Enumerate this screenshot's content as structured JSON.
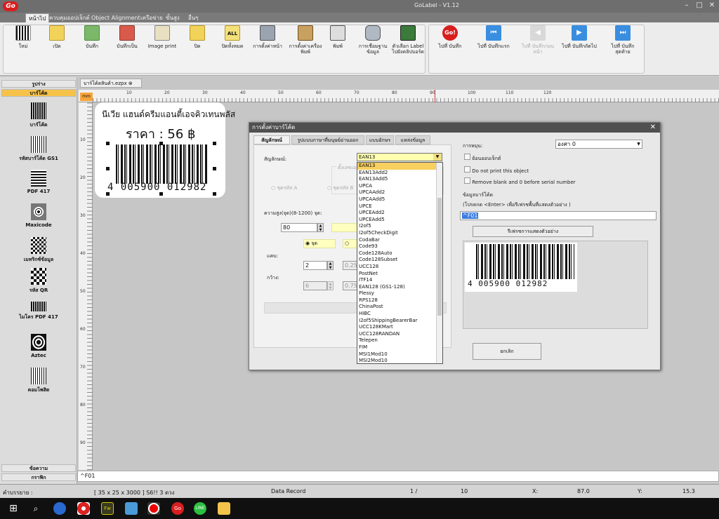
{
  "app": {
    "title": "GoLabel - V1.12",
    "logo": "Go"
  },
  "menu": [
    "หน้าไป",
    "ควบคุมออปเจ็กต์",
    "Object Alignment",
    "เครือข่าย",
    "ขั้นสูง",
    "อื่นๆ"
  ],
  "ribbon": {
    "buttons": [
      "ใหม่",
      "เปิด",
      "บันทึก",
      "บันทึกเป็น",
      "Image print",
      "ปิด",
      "ปิดทั้งหมด",
      "การตั้งค่าหน้า",
      "การตั้งค่าเครื่อง\nพิมพ์",
      "พิมพ์",
      "การเชื่อมฐาน\nข้อมูล",
      "ตัวเลือก Label\nไปยังคลิปบอร์ด"
    ],
    "nav_buttons": [
      "ไปที่ บันทึก",
      "ไปที่ บันทึกแรก",
      "ไปที่ บันทึกก่อนหน้า",
      "ไปที่ บันทึกถัดไป",
      "ไปที่ บันทึกสุดท้าย"
    ]
  },
  "left_panel": {
    "top_headers": [
      "รูปร่าง",
      "บาร์โค้ด"
    ],
    "items": [
      "บาร์โค้ด",
      "รหัสบาร์โค้ด GS1",
      "PDF 417",
      "Maxicode",
      "เมทริกซ์ข้อมูล",
      "รหัส QR",
      "ไมโคร PDF 417",
      "Aztec",
      "คอมโพสิต"
    ],
    "bottom_headers": [
      "ข้อความ",
      "กราฟิก"
    ]
  },
  "document": {
    "tab": "บาร์โค้ดสินค้า.ezpx",
    "unit": "mm",
    "hruler": [
      "10",
      "20",
      "30",
      "40",
      "50",
      "60",
      "70",
      "80",
      "90",
      "100",
      "110",
      "120"
    ],
    "vruler": [
      "10",
      "20",
      "30",
      "40",
      "50",
      "60",
      "70",
      "80",
      "90"
    ]
  },
  "label": {
    "line1": "นีเวีย แฮนด์ครีมแอนตี้เอจคิวเทนพลัส",
    "line2": "ราคา : 56 ฿",
    "hri": "4  005900  012982"
  },
  "dialog": {
    "title": "การตั้งค่าบาร์โค้ด",
    "tabs": [
      "สัญลักษณ์",
      "รูปแบบภาษาที่มนุษย์อ่านออก",
      "แบบอักษร",
      "แหล่งข้อมูล"
    ],
    "symbol_label": "สัญลักษณ์:",
    "symbol_value": "EAN13",
    "disabled_group": "ตั้งเลขเอง",
    "radio_a": "ชุดรหัส A",
    "radio_b": "ชุดรหัส B",
    "height_label": "ความสูง(จุด)(8-1200) จุด:",
    "height_value": "80",
    "unit_dot": "จุด",
    "narrow_label": "แคบ:",
    "narrow_value": "2",
    "narrow_ratio": "0.25",
    "wide_label": "กว้าง:",
    "wide_value": "6",
    "wide_ratio": "0.75",
    "disabled_btn": "อัตราส่วนบาร์",
    "rotate_label": "การหมุน:",
    "rotate_value": "องศา 0",
    "cb_inverse": "ย้อนออบเจ็กต์",
    "cb_noprint": "Do not print this object",
    "cb_remove": "Remove blank and 0 before serial number",
    "data_label": "ข้อมูลบาร์โค้ด",
    "data_hint": "(โปรดกด <Enter> เพื่อรีเฟรชพื้นที่แสดงตัวอย่าง )",
    "data_value": "^F01",
    "refresh_btn": "รีเฟรชการแสดงตัวอย่าง",
    "preview_hri": "4  005900  012982",
    "cancel_btn": "ยกเลิก",
    "options": [
      "EAN13",
      "EAN13Add2",
      "EAN13Add5",
      "UPCA",
      "UPCAAdd2",
      "UPCAAdd5",
      "UPCE",
      "UPCEAdd2",
      "UPCEAdd5",
      "I2of5",
      "I2of5CheckDigit",
      "CodaBar",
      "Code93",
      "Code128Auto",
      "Code128Subset",
      "UCC128",
      "PostNet",
      "ITF14",
      "EAN128 (GS1-128)",
      "Plessy",
      "RPS128",
      "ChinaPost",
      "HIBC",
      "I2of5ShippingBearerBar",
      "UCC128KMart",
      "UCC128RANDAN",
      "Telepen",
      "FIM",
      "MSI1Mod10",
      "MSI2Mod10"
    ]
  },
  "command": "^F01",
  "status": {
    "label": "คำบรรยาย :",
    "size": "[ 35 x 25 x 3000 ]  S6!! 3 ดวง",
    "record": "Data Record",
    "page": "1 /",
    "total": "10",
    "x_label": "X:",
    "x_value": "87.0",
    "y_label": "Y:",
    "y_value": "15.3"
  },
  "colors": {
    "accent": "#f6c24a",
    "select": "#f8d060",
    "title": "#505050"
  }
}
